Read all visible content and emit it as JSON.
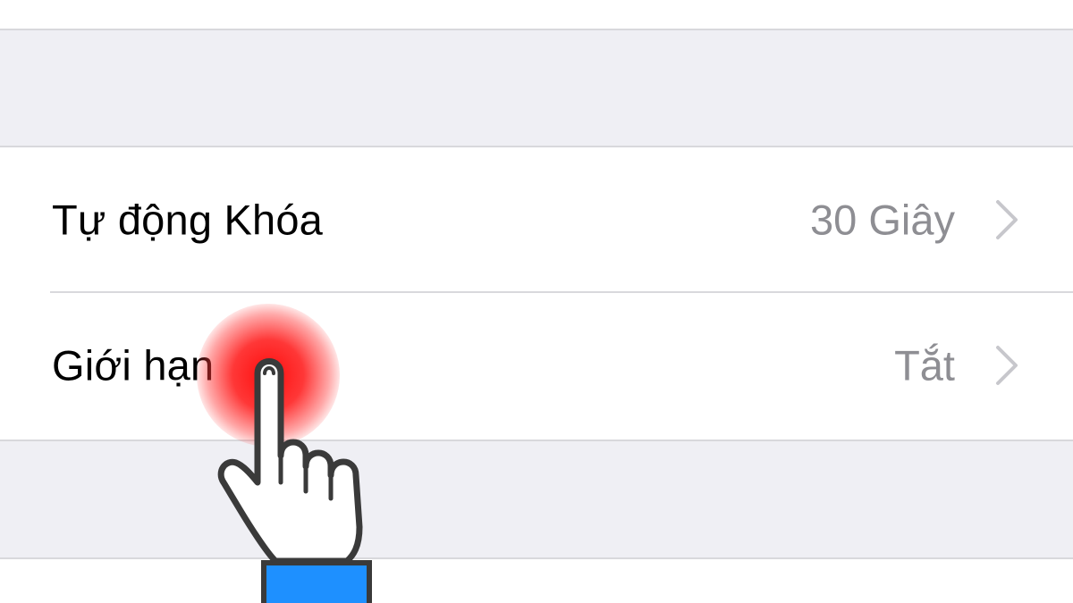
{
  "settings": {
    "rows": [
      {
        "label": "Tự động Khóa",
        "value": "30 Giây"
      },
      {
        "label": "Giới hạn",
        "value": "Tắt"
      }
    ]
  },
  "colors": {
    "group_background": "#efeff4",
    "cell_background": "#ffffff",
    "separator": "#d8d8dc",
    "label_text": "#000000",
    "value_text": "#8e8e93",
    "tap_highlight": "#ff1a1a",
    "cuff": "#1e90ff"
  },
  "icons": {
    "chevron": "chevron-right-icon",
    "pointer": "pointing-hand-icon"
  }
}
